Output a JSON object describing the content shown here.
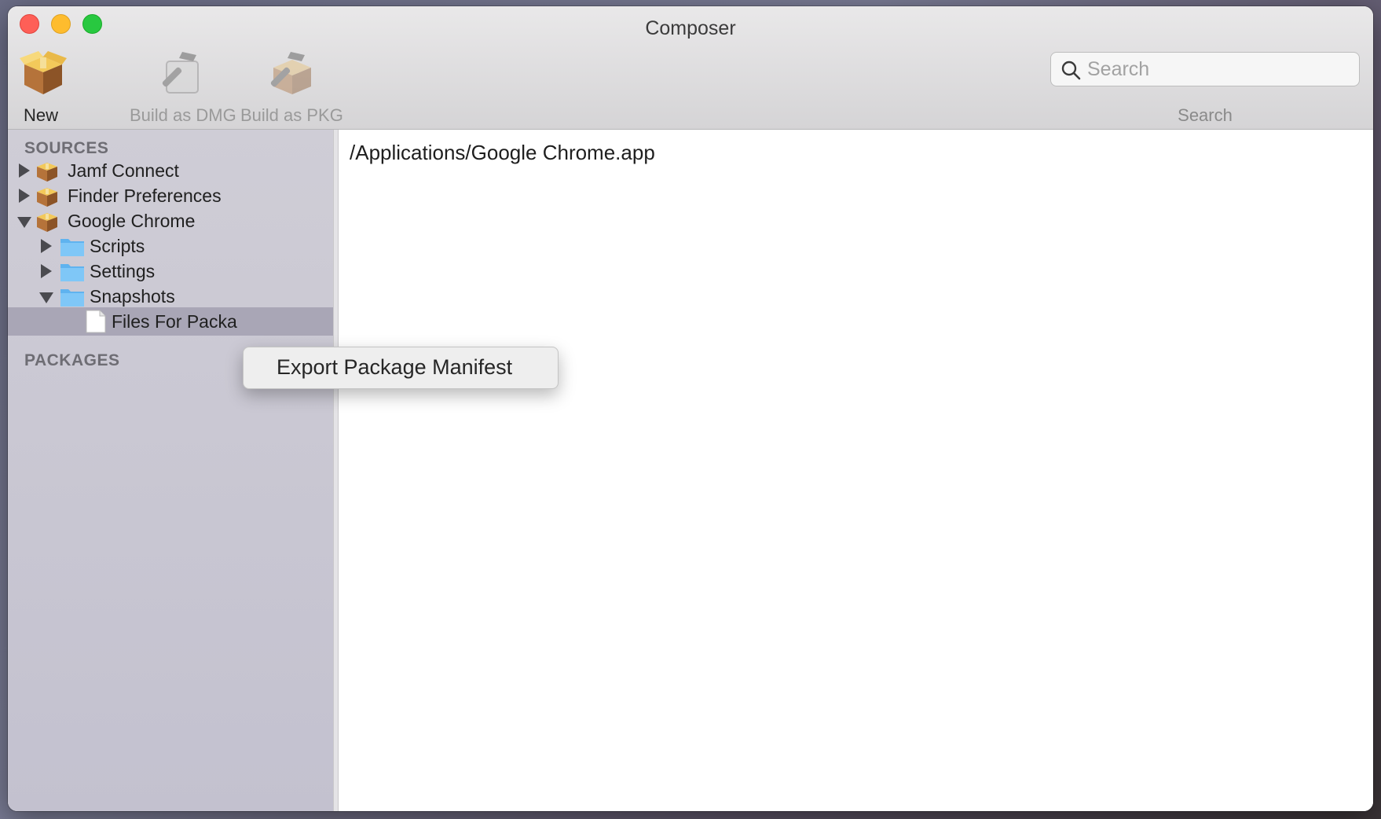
{
  "window": {
    "title": "Composer"
  },
  "toolbar": {
    "items": [
      {
        "label": "New",
        "icon": "package-box-icon",
        "enabled": true
      },
      {
        "label": "Build as DMG",
        "icon": "build-dmg-icon",
        "enabled": false
      },
      {
        "label": "Build as PKG",
        "icon": "build-pkg-icon",
        "enabled": false
      }
    ],
    "search": {
      "placeholder": "Search",
      "value": "",
      "caption": "Search"
    }
  },
  "sidebar": {
    "sources_header": "SOURCES",
    "packages_header": "PACKAGES",
    "tree": [
      {
        "label": "Jamf Connect",
        "icon": "package-box-icon",
        "expanded": false
      },
      {
        "label": "Finder Preferences",
        "icon": "package-box-icon",
        "expanded": false
      },
      {
        "label": "Google Chrome",
        "icon": "package-box-icon",
        "expanded": true
      },
      {
        "label": "Scripts",
        "icon": "folder-icon",
        "expanded": false
      },
      {
        "label": "Settings",
        "icon": "folder-icon",
        "expanded": false
      },
      {
        "label": "Snapshots",
        "icon": "folder-icon",
        "expanded": true
      },
      {
        "label": "Files For Packa",
        "icon": "document-icon",
        "selected": true
      }
    ]
  },
  "content": {
    "path": "/Applications/Google Chrome.app"
  },
  "context_menu": {
    "items": [
      {
        "label": "Export Package Manifest"
      }
    ]
  },
  "colors": {
    "close": "#fe5f57",
    "minimize": "#febc2e",
    "maximize": "#28c840",
    "sidebar_bg": "#c9c7d3",
    "selection": "#a9a6b6",
    "folder": "#6cbdf5"
  }
}
